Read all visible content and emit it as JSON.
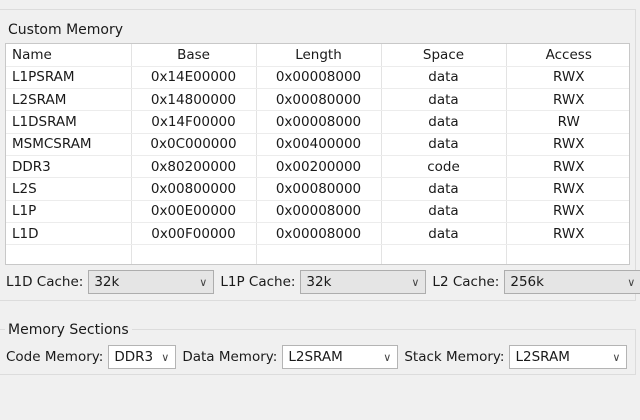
{
  "custom_memory": {
    "title": "Custom Memory",
    "columns": [
      "Name",
      "Base",
      "Length",
      "Space",
      "Access"
    ],
    "rows": [
      [
        "L1PSRAM",
        "0x14E00000",
        "0x00008000",
        "data",
        "RWX"
      ],
      [
        "L2SRAM",
        "0x14800000",
        "0x00080000",
        "data",
        "RWX"
      ],
      [
        "L1DSRAM",
        "0x14F00000",
        "0x00008000",
        "data",
        "RW"
      ],
      [
        "MSMCSRAM",
        "0x0C000000",
        "0x00400000",
        "data",
        "RWX"
      ],
      [
        "DDR3",
        "0x80200000",
        "0x00200000",
        "code",
        "RWX"
      ],
      [
        "L2S",
        "0x00800000",
        "0x00080000",
        "data",
        "RWX"
      ],
      [
        "L1P",
        "0x00E00000",
        "0x00008000",
        "data",
        "RWX"
      ],
      [
        "L1D",
        "0x00F00000",
        "0x00008000",
        "data",
        "RWX"
      ]
    ],
    "l1d_cache": {
      "label": "L1D Cache:",
      "value": "32k"
    },
    "l1p_cache": {
      "label": "L1P Cache:",
      "value": "32k"
    },
    "l2_cache": {
      "label": "L2 Cache:",
      "value": "256k"
    }
  },
  "memory_sections": {
    "title": "Memory Sections",
    "code_memory": {
      "label": "Code Memory:",
      "value": "DDR3"
    },
    "data_memory": {
      "label": "Data Memory:",
      "value": "L2SRAM"
    },
    "stack_memory": {
      "label": "Stack Memory:",
      "value": "L2SRAM"
    }
  },
  "icons": {
    "dropdown": "chevron-down-icon"
  }
}
